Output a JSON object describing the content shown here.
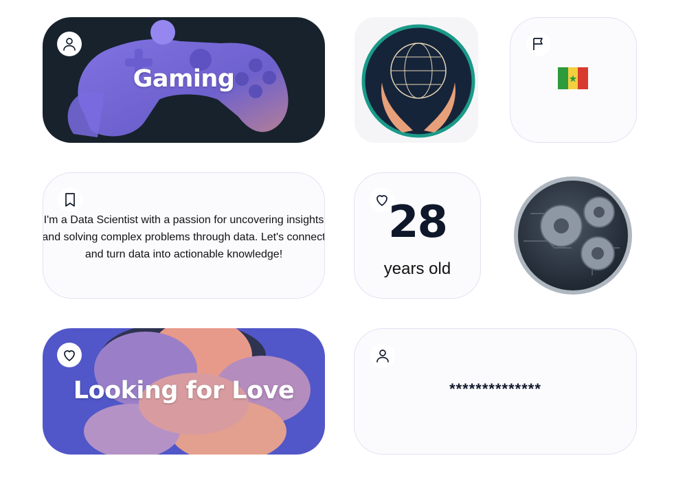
{
  "cards": {
    "gaming": {
      "title": "Gaming",
      "icon": "user-icon"
    },
    "world": {
      "image": "globe-in-hands-illustration"
    },
    "country": {
      "flag": "🇸🇳",
      "icon": "flag-icon"
    },
    "bio": {
      "text": "I'm a Data Scientist with a passion for uncovering insights and solving complex problems through data. Let's connect and turn data into actionable knowledge!",
      "icon": "bookmark-icon"
    },
    "age": {
      "number": "28",
      "label": "years old",
      "icon": "heart-icon"
    },
    "tech": {
      "image": "gears-circuit-badge"
    },
    "love": {
      "title": "Looking for Love",
      "icon": "heart-icon"
    },
    "hidden": {
      "value": "**************",
      "icon": "user-icon"
    }
  },
  "colors": {
    "gaming_bg": "#17222c",
    "gaming_controller": "#8e7cf0",
    "love_bg": "#5157c8",
    "love_cloud": "#e89a8a",
    "globe_ring": "#1b9a88",
    "card_border": "#e4e0f3"
  }
}
